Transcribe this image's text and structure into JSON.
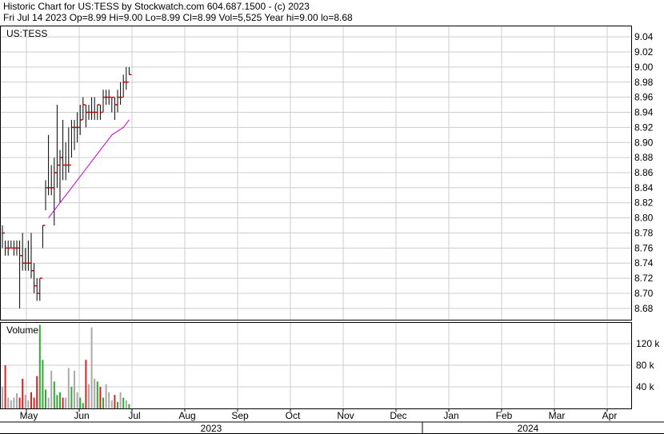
{
  "header": {
    "line1": "Historic Chart for US:TESS by Stockwatch.com 604.687.1500 - (c) 2023",
    "line2": "Fri Jul 14 2023  Op=8.99  Hi=9.00  Lo=8.99  Cl=8.99  Vol=5,525  Year hi=9.00  lo=8.68"
  },
  "colors": {
    "up": "#cc0000",
    "bar": "#000000",
    "ma": "#cc00cc",
    "vol_up": "#33aa33",
    "vol_down": "#dd2222",
    "vol_flat": "#aaaaaa",
    "grid": "#cccccc"
  },
  "chart_data": [
    {
      "type": "ohlc",
      "label": "US:TESS",
      "y_ticks": [
        "9.04",
        "9.02",
        "9.00",
        "8.98",
        "8.96",
        "8.94",
        "8.92",
        "8.90",
        "8.88",
        "8.86",
        "8.84",
        "8.82",
        "8.80",
        "8.78",
        "8.76",
        "8.74",
        "8.72",
        "8.70",
        "8.68"
      ],
      "ylim": [
        8.665,
        9.055
      ],
      "x_ticks": [
        "May",
        "Jun",
        "Jul",
        "Aug",
        "Sep",
        "Oct",
        "Nov",
        "Dec",
        "Jan",
        "Feb",
        "Mar",
        "Apr"
      ],
      "years": [
        "2023",
        "2024"
      ],
      "bars": [
        {
          "h": 8.79,
          "l": 8.76,
          "c": 8.78
        },
        {
          "h": 8.77,
          "l": 8.75,
          "c": 8.76
        },
        {
          "h": 8.77,
          "l": 8.75,
          "c": 8.76
        },
        {
          "h": 8.77,
          "l": 8.76,
          "c": 8.76
        },
        {
          "h": 8.77,
          "l": 8.75,
          "c": 8.76
        },
        {
          "h": 8.77,
          "l": 8.75,
          "c": 8.76
        },
        {
          "h": 8.77,
          "l": 8.68,
          "c": 8.75
        },
        {
          "h": 8.78,
          "l": 8.73,
          "c": 8.74
        },
        {
          "h": 8.76,
          "l": 8.73,
          "c": 8.74
        },
        {
          "h": 8.77,
          "l": 8.73,
          "c": 8.74
        },
        {
          "h": 8.78,
          "l": 8.72,
          "c": 8.73
        },
        {
          "h": 8.74,
          "l": 8.7,
          "c": 8.71
        },
        {
          "h": 8.72,
          "l": 8.69,
          "c": 8.7
        },
        {
          "h": 8.72,
          "l": 8.69,
          "c": 8.72
        },
        {
          "h": 8.79,
          "l": 8.76,
          "c": 8.79
        },
        {
          "h": 8.85,
          "l": 8.81,
          "c": 8.84
        },
        {
          "h": 8.91,
          "l": 8.83,
          "c": 8.84
        },
        {
          "h": 8.87,
          "l": 8.83,
          "c": 8.84
        },
        {
          "h": 8.88,
          "l": 8.79,
          "c": 8.86
        },
        {
          "h": 8.95,
          "l": 8.84,
          "c": 8.87
        },
        {
          "h": 8.89,
          "l": 8.82,
          "c": 8.88
        },
        {
          "h": 8.93,
          "l": 8.85,
          "c": 8.87
        },
        {
          "h": 8.9,
          "l": 8.85,
          "c": 8.87
        },
        {
          "h": 8.92,
          "l": 8.86,
          "c": 8.87
        },
        {
          "h": 8.93,
          "l": 8.88,
          "c": 8.92
        },
        {
          "h": 8.93,
          "l": 8.89,
          "c": 8.92
        },
        {
          "h": 8.94,
          "l": 8.9,
          "c": 8.92
        },
        {
          "h": 8.95,
          "l": 8.91,
          "c": 8.93
        },
        {
          "h": 8.96,
          "l": 8.93,
          "c": 8.95
        },
        {
          "h": 8.95,
          "l": 8.92,
          "c": 8.94
        },
        {
          "h": 8.95,
          "l": 8.93,
          "c": 8.94
        },
        {
          "h": 8.96,
          "l": 8.93,
          "c": 8.94
        },
        {
          "h": 8.96,
          "l": 8.93,
          "c": 8.94
        },
        {
          "h": 8.95,
          "l": 8.93,
          "c": 8.95
        },
        {
          "h": 8.95,
          "l": 8.93,
          "c": 8.94
        },
        {
          "h": 8.97,
          "l": 8.94,
          "c": 8.96
        },
        {
          "h": 8.97,
          "l": 8.95,
          "c": 8.96
        },
        {
          "h": 8.97,
          "l": 8.95,
          "c": 8.96
        },
        {
          "h": 8.96,
          "l": 8.94,
          "c": 8.96
        },
        {
          "h": 8.96,
          "l": 8.93,
          "c": 8.95
        },
        {
          "h": 8.97,
          "l": 8.94,
          "c": 8.96
        },
        {
          "h": 8.98,
          "l": 8.95,
          "c": 8.96
        },
        {
          "h": 8.99,
          "l": 8.96,
          "c": 8.98
        },
        {
          "h": 9.0,
          "l": 8.97,
          "c": 8.98
        },
        {
          "h": 9.0,
          "l": 8.99,
          "c": 8.99
        }
      ],
      "ma": [
        8.8,
        8.81,
        8.82,
        8.83,
        8.84,
        8.85,
        8.86,
        8.87,
        8.88,
        8.89,
        8.9,
        8.91,
        8.915,
        8.92,
        8.93
      ]
    },
    {
      "type": "bar",
      "label": "Volume",
      "y_ticks": [
        "120 k",
        "80 k",
        "40 k"
      ],
      "ylim": [
        0,
        160000
      ],
      "values": [
        40000,
        80000,
        20000,
        15000,
        20000,
        28000,
        20000,
        55000,
        25000,
        15000,
        30000,
        20000,
        60000,
        155000,
        90000,
        35000,
        20000,
        70000,
        50000,
        25000,
        30000,
        20000,
        20000,
        75000,
        40000,
        70000,
        30000,
        20000,
        10000,
        90000,
        45000,
        150000,
        55000,
        50000,
        40000,
        20000,
        45000,
        30000,
        15000,
        25000,
        12000,
        30000,
        20000,
        15000,
        8000
      ]
    }
  ]
}
